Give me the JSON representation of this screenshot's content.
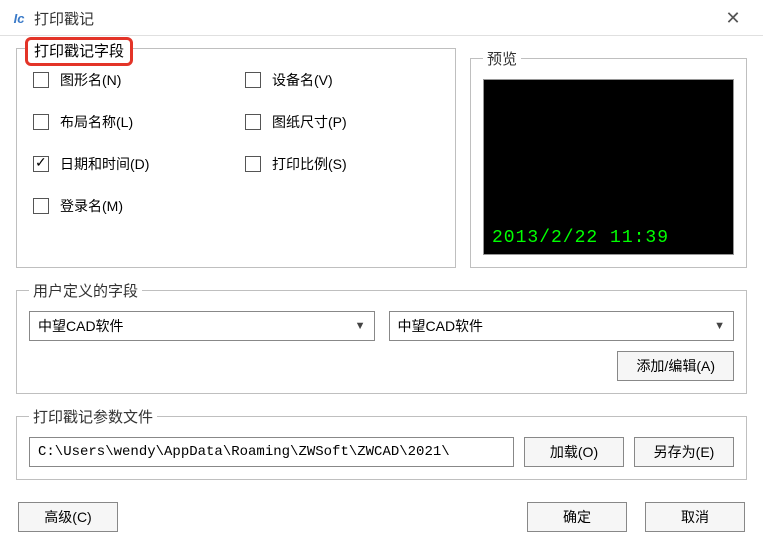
{
  "window": {
    "title": "打印戳记",
    "icon_label": "Ic"
  },
  "fields_group": {
    "legend": "打印戳记字段",
    "items": [
      {
        "label": "图形名(N)",
        "checked": false
      },
      {
        "label": "设备名(V)",
        "checked": false
      },
      {
        "label": "布局名称(L)",
        "checked": false
      },
      {
        "label": "图纸尺寸(P)",
        "checked": false
      },
      {
        "label": "日期和时间(D)",
        "checked": true
      },
      {
        "label": "打印比例(S)",
        "checked": false
      },
      {
        "label": "登录名(M)",
        "checked": false
      }
    ]
  },
  "preview": {
    "legend": "预览",
    "stamp_text": "2013/2/22 11:39"
  },
  "user_defined": {
    "legend": "用户定义的字段",
    "combo1": "中望CAD软件",
    "combo2": "中望CAD软件",
    "add_edit_btn": "添加/编辑(A)"
  },
  "param_file": {
    "legend": "打印戳记参数文件",
    "path": "C:\\Users\\wendy\\AppData\\Roaming\\ZWSoft\\ZWCAD\\2021\\",
    "load_btn": "加载(O)",
    "save_as_btn": "另存为(E)"
  },
  "bottom": {
    "advanced_btn": "高级(C)",
    "ok_btn": "确定",
    "cancel_btn": "取消"
  }
}
